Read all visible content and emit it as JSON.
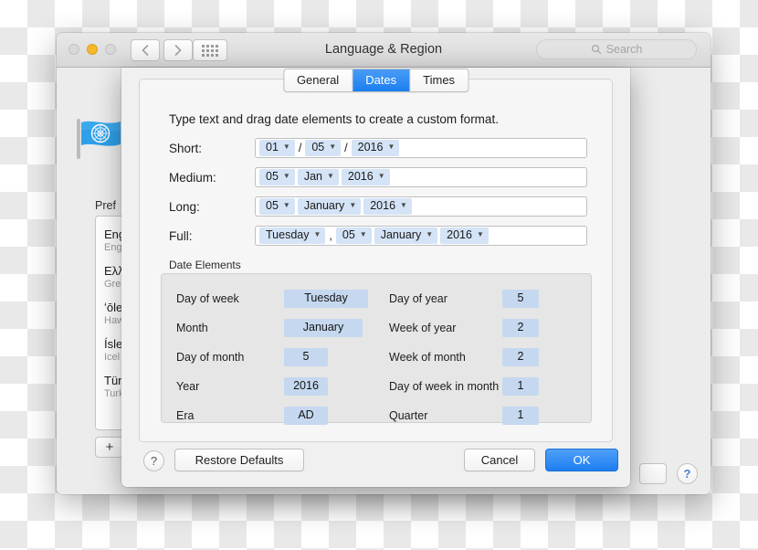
{
  "window": {
    "title": "Language & Region",
    "search": {
      "placeholder": "Search",
      "icon": "search-icon"
    },
    "traffic_lights": [
      "close",
      "minimize",
      "zoom"
    ],
    "nav": {
      "back": "back-icon",
      "forward": "forward-icon",
      "show_all": "grid-icon"
    }
  },
  "background_pane": {
    "icon": "un-flag-icon",
    "preferred_label": "Pref",
    "languages": [
      {
        "name": "Eng",
        "sub": "Eng"
      },
      {
        "name": "Ελλ",
        "sub": "Gre"
      },
      {
        "name": "ʻōle",
        "sub": "Haw"
      },
      {
        "name": "Ísle",
        "sub": "Icel"
      },
      {
        "name": "Tür",
        "sub": "Turk"
      }
    ],
    "add_button": "+",
    "help_button": "?"
  },
  "sheet": {
    "tabs": [
      {
        "label": "General",
        "active": false
      },
      {
        "label": "Dates",
        "active": true
      },
      {
        "label": "Times",
        "active": false
      }
    ],
    "instruction": "Type text and drag date elements to create a custom format.",
    "formats": [
      {
        "label": "Short:",
        "parts": [
          {
            "type": "token",
            "text": "01"
          },
          {
            "type": "sep",
            "text": "/"
          },
          {
            "type": "token",
            "text": "05"
          },
          {
            "type": "sep",
            "text": "/"
          },
          {
            "type": "token",
            "text": "2016"
          }
        ]
      },
      {
        "label": "Medium:",
        "parts": [
          {
            "type": "token",
            "text": "05"
          },
          {
            "type": "token",
            "text": "Jan"
          },
          {
            "type": "token",
            "text": "2016"
          }
        ]
      },
      {
        "label": "Long:",
        "parts": [
          {
            "type": "token",
            "text": "05"
          },
          {
            "type": "token",
            "text": "January"
          },
          {
            "type": "token",
            "text": "2016"
          }
        ]
      },
      {
        "label": "Full:",
        "parts": [
          {
            "type": "token",
            "text": "Tuesday"
          },
          {
            "type": "sep",
            "text": ","
          },
          {
            "type": "token",
            "text": "05"
          },
          {
            "type": "token",
            "text": "January"
          },
          {
            "type": "token",
            "text": "2016"
          }
        ]
      }
    ],
    "date_elements": {
      "title": "Date Elements",
      "left": [
        {
          "name": "Day of week",
          "value": "Tuesday",
          "width": "w-wide"
        },
        {
          "name": "Month",
          "value": "January",
          "width": "w-med"
        },
        {
          "name": "Day of month",
          "value": "5",
          "width": "w-narrow"
        },
        {
          "name": "Year",
          "value": "2016",
          "width": "w-narrow"
        },
        {
          "name": "Era",
          "value": "AD",
          "width": "w-narrow"
        }
      ],
      "right": [
        {
          "name": "Day of year",
          "value": "5",
          "width": "w-num"
        },
        {
          "name": "Week of year",
          "value": "2",
          "width": "w-num"
        },
        {
          "name": "Week of month",
          "value": "2",
          "width": "w-num"
        },
        {
          "name": "Day of week in month",
          "value": "1",
          "width": "w-num"
        },
        {
          "name": "Quarter",
          "value": "1",
          "width": "w-num"
        }
      ]
    },
    "footer": {
      "help": "?",
      "restore": "Restore Defaults",
      "cancel": "Cancel",
      "ok": "OK"
    }
  },
  "colors": {
    "accent": "#1d7ef1",
    "token_bg": "#d4e3f6",
    "element_value_bg": "#c5d8ef"
  }
}
